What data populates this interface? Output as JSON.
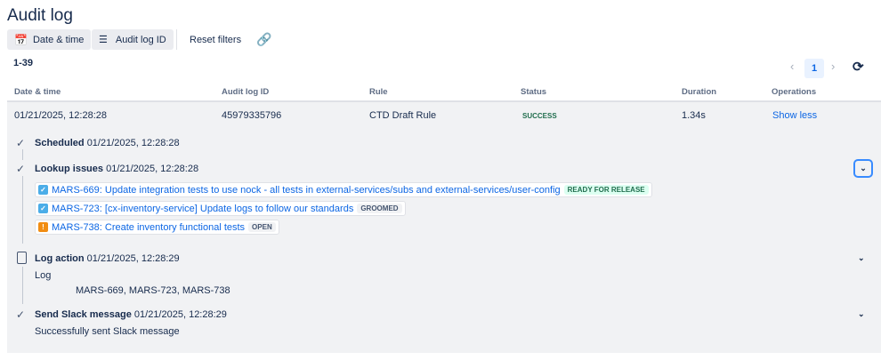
{
  "title": "Audit log",
  "toolbar": {
    "date_time": "Date & time",
    "audit_log_id": "Audit log ID",
    "reset": "Reset filters"
  },
  "count": "1-39",
  "pagination": {
    "page": "1"
  },
  "columns": [
    "Date & time",
    "Audit log ID",
    "Rule",
    "Status",
    "Duration",
    "Operations"
  ],
  "row": {
    "date": "01/21/2025, 12:28:28",
    "id": "45979335796",
    "rule": "CTD Draft Rule",
    "status": "SUCCESS",
    "duration": "1.34s",
    "operation": "Show less"
  },
  "steps": [
    {
      "name": "Scheduled",
      "time": "01/21/2025, 12:28:28"
    },
    {
      "name": "Lookup issues",
      "time": "01/21/2025, 12:28:28"
    },
    {
      "name": "Log action",
      "time": "01/21/2025, 12:28:29",
      "label": "Log",
      "detail": "MARS-669, MARS-723, MARS-738"
    },
    {
      "name": "Send Slack message",
      "time": "01/21/2025, 12:28:29",
      "detail": "Successfully sent Slack message"
    }
  ],
  "issues": [
    {
      "text": "MARS-669: Update integration tests to use nock - all tests in external-services/subs and external-services/user-config",
      "status": "READY FOR RELEASE",
      "type": "task"
    },
    {
      "text": "MARS-723: [cx-inventory-service] Update logs to follow our standards",
      "status": "GROOMED",
      "type": "task"
    },
    {
      "text": "MARS-738: Create inventory functional tests",
      "status": "OPEN",
      "type": "bug"
    }
  ],
  "colors": {
    "success": "#216e4e",
    "link": "#0c66e4",
    "panel": "#f1f2f4"
  }
}
